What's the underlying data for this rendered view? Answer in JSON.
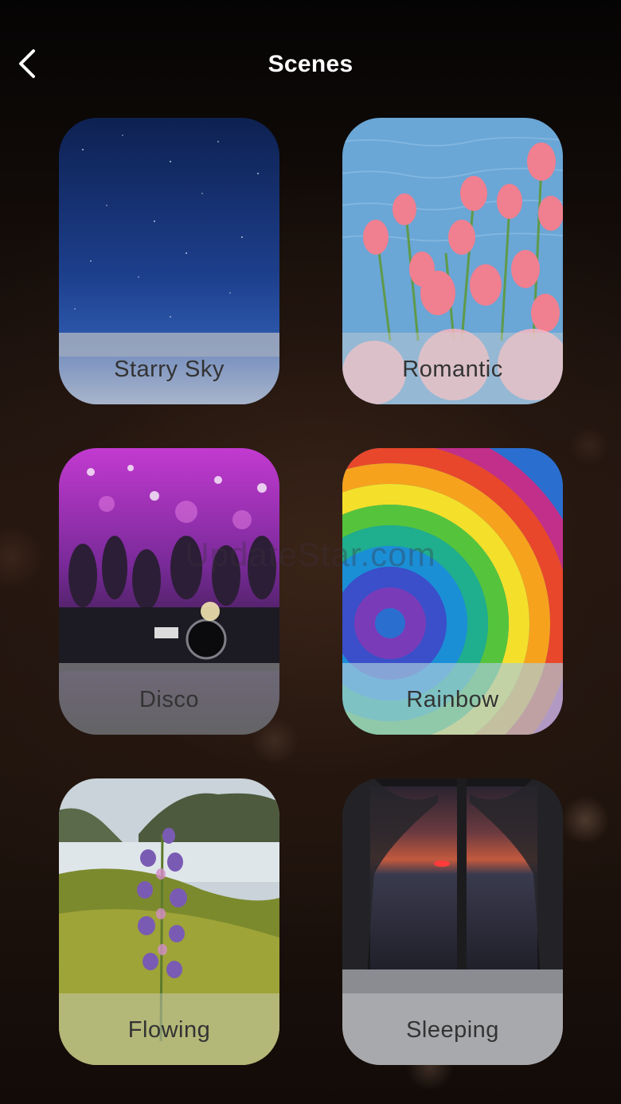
{
  "header": {
    "title": "Scenes",
    "back_icon": "chevron-left-icon"
  },
  "scenes": [
    {
      "label": "Starry Sky"
    },
    {
      "label": "Romantic"
    },
    {
      "label": "Disco"
    },
    {
      "label": "Rainbow"
    },
    {
      "label": "Flowing"
    },
    {
      "label": "Sleeping"
    }
  ],
  "watermark": "UpdateStar.com",
  "colors": {
    "title_text": "#ffffff",
    "label_text": "#333333",
    "background": "#1e130d"
  }
}
